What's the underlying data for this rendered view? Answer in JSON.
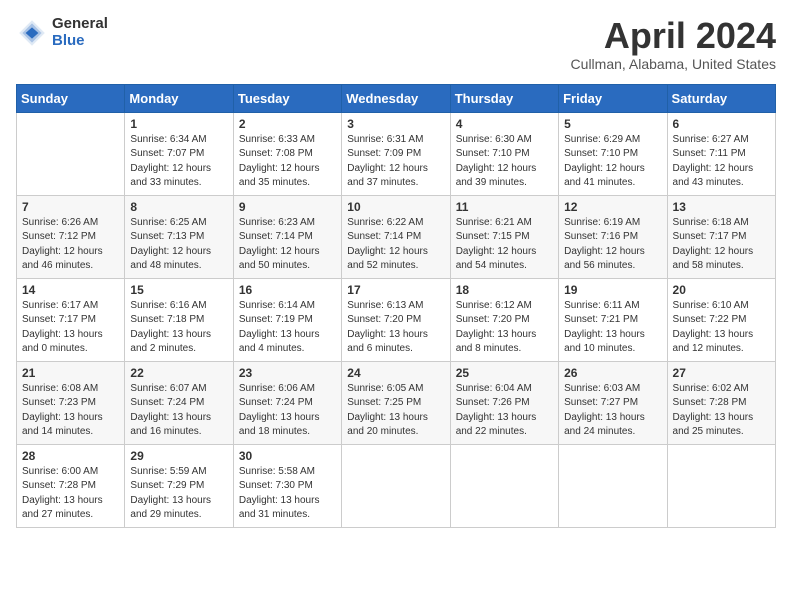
{
  "header": {
    "logo_general": "General",
    "logo_blue": "Blue",
    "month_title": "April 2024",
    "location": "Cullman, Alabama, United States"
  },
  "days_of_week": [
    "Sunday",
    "Monday",
    "Tuesday",
    "Wednesday",
    "Thursday",
    "Friday",
    "Saturday"
  ],
  "weeks": [
    [
      {
        "num": "",
        "sunrise": "",
        "sunset": "",
        "daylight": ""
      },
      {
        "num": "1",
        "sunrise": "Sunrise: 6:34 AM",
        "sunset": "Sunset: 7:07 PM",
        "daylight": "Daylight: 12 hours and 33 minutes."
      },
      {
        "num": "2",
        "sunrise": "Sunrise: 6:33 AM",
        "sunset": "Sunset: 7:08 PM",
        "daylight": "Daylight: 12 hours and 35 minutes."
      },
      {
        "num": "3",
        "sunrise": "Sunrise: 6:31 AM",
        "sunset": "Sunset: 7:09 PM",
        "daylight": "Daylight: 12 hours and 37 minutes."
      },
      {
        "num": "4",
        "sunrise": "Sunrise: 6:30 AM",
        "sunset": "Sunset: 7:10 PM",
        "daylight": "Daylight: 12 hours and 39 minutes."
      },
      {
        "num": "5",
        "sunrise": "Sunrise: 6:29 AM",
        "sunset": "Sunset: 7:10 PM",
        "daylight": "Daylight: 12 hours and 41 minutes."
      },
      {
        "num": "6",
        "sunrise": "Sunrise: 6:27 AM",
        "sunset": "Sunset: 7:11 PM",
        "daylight": "Daylight: 12 hours and 43 minutes."
      }
    ],
    [
      {
        "num": "7",
        "sunrise": "Sunrise: 6:26 AM",
        "sunset": "Sunset: 7:12 PM",
        "daylight": "Daylight: 12 hours and 46 minutes."
      },
      {
        "num": "8",
        "sunrise": "Sunrise: 6:25 AM",
        "sunset": "Sunset: 7:13 PM",
        "daylight": "Daylight: 12 hours and 48 minutes."
      },
      {
        "num": "9",
        "sunrise": "Sunrise: 6:23 AM",
        "sunset": "Sunset: 7:14 PM",
        "daylight": "Daylight: 12 hours and 50 minutes."
      },
      {
        "num": "10",
        "sunrise": "Sunrise: 6:22 AM",
        "sunset": "Sunset: 7:14 PM",
        "daylight": "Daylight: 12 hours and 52 minutes."
      },
      {
        "num": "11",
        "sunrise": "Sunrise: 6:21 AM",
        "sunset": "Sunset: 7:15 PM",
        "daylight": "Daylight: 12 hours and 54 minutes."
      },
      {
        "num": "12",
        "sunrise": "Sunrise: 6:19 AM",
        "sunset": "Sunset: 7:16 PM",
        "daylight": "Daylight: 12 hours and 56 minutes."
      },
      {
        "num": "13",
        "sunrise": "Sunrise: 6:18 AM",
        "sunset": "Sunset: 7:17 PM",
        "daylight": "Daylight: 12 hours and 58 minutes."
      }
    ],
    [
      {
        "num": "14",
        "sunrise": "Sunrise: 6:17 AM",
        "sunset": "Sunset: 7:17 PM",
        "daylight": "Daylight: 13 hours and 0 minutes."
      },
      {
        "num": "15",
        "sunrise": "Sunrise: 6:16 AM",
        "sunset": "Sunset: 7:18 PM",
        "daylight": "Daylight: 13 hours and 2 minutes."
      },
      {
        "num": "16",
        "sunrise": "Sunrise: 6:14 AM",
        "sunset": "Sunset: 7:19 PM",
        "daylight": "Daylight: 13 hours and 4 minutes."
      },
      {
        "num": "17",
        "sunrise": "Sunrise: 6:13 AM",
        "sunset": "Sunset: 7:20 PM",
        "daylight": "Daylight: 13 hours and 6 minutes."
      },
      {
        "num": "18",
        "sunrise": "Sunrise: 6:12 AM",
        "sunset": "Sunset: 7:20 PM",
        "daylight": "Daylight: 13 hours and 8 minutes."
      },
      {
        "num": "19",
        "sunrise": "Sunrise: 6:11 AM",
        "sunset": "Sunset: 7:21 PM",
        "daylight": "Daylight: 13 hours and 10 minutes."
      },
      {
        "num": "20",
        "sunrise": "Sunrise: 6:10 AM",
        "sunset": "Sunset: 7:22 PM",
        "daylight": "Daylight: 13 hours and 12 minutes."
      }
    ],
    [
      {
        "num": "21",
        "sunrise": "Sunrise: 6:08 AM",
        "sunset": "Sunset: 7:23 PM",
        "daylight": "Daylight: 13 hours and 14 minutes."
      },
      {
        "num": "22",
        "sunrise": "Sunrise: 6:07 AM",
        "sunset": "Sunset: 7:24 PM",
        "daylight": "Daylight: 13 hours and 16 minutes."
      },
      {
        "num": "23",
        "sunrise": "Sunrise: 6:06 AM",
        "sunset": "Sunset: 7:24 PM",
        "daylight": "Daylight: 13 hours and 18 minutes."
      },
      {
        "num": "24",
        "sunrise": "Sunrise: 6:05 AM",
        "sunset": "Sunset: 7:25 PM",
        "daylight": "Daylight: 13 hours and 20 minutes."
      },
      {
        "num": "25",
        "sunrise": "Sunrise: 6:04 AM",
        "sunset": "Sunset: 7:26 PM",
        "daylight": "Daylight: 13 hours and 22 minutes."
      },
      {
        "num": "26",
        "sunrise": "Sunrise: 6:03 AM",
        "sunset": "Sunset: 7:27 PM",
        "daylight": "Daylight: 13 hours and 24 minutes."
      },
      {
        "num": "27",
        "sunrise": "Sunrise: 6:02 AM",
        "sunset": "Sunset: 7:28 PM",
        "daylight": "Daylight: 13 hours and 25 minutes."
      }
    ],
    [
      {
        "num": "28",
        "sunrise": "Sunrise: 6:00 AM",
        "sunset": "Sunset: 7:28 PM",
        "daylight": "Daylight: 13 hours and 27 minutes."
      },
      {
        "num": "29",
        "sunrise": "Sunrise: 5:59 AM",
        "sunset": "Sunset: 7:29 PM",
        "daylight": "Daylight: 13 hours and 29 minutes."
      },
      {
        "num": "30",
        "sunrise": "Sunrise: 5:58 AM",
        "sunset": "Sunset: 7:30 PM",
        "daylight": "Daylight: 13 hours and 31 minutes."
      },
      {
        "num": "",
        "sunrise": "",
        "sunset": "",
        "daylight": ""
      },
      {
        "num": "",
        "sunrise": "",
        "sunset": "",
        "daylight": ""
      },
      {
        "num": "",
        "sunrise": "",
        "sunset": "",
        "daylight": ""
      },
      {
        "num": "",
        "sunrise": "",
        "sunset": "",
        "daylight": ""
      }
    ]
  ]
}
